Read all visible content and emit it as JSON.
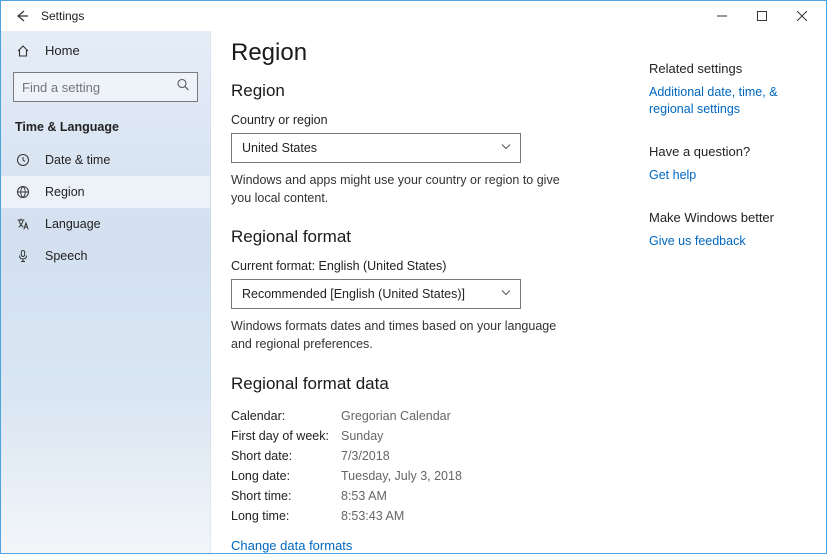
{
  "window": {
    "title": "Settings"
  },
  "sidebar": {
    "home_label": "Home",
    "search_placeholder": "Find a setting",
    "heading": "Time & Language",
    "items": [
      {
        "label": "Date & time"
      },
      {
        "label": "Region"
      },
      {
        "label": "Language"
      },
      {
        "label": "Speech"
      }
    ]
  },
  "page": {
    "title": "Region",
    "region": {
      "heading": "Region",
      "label": "Country or region",
      "value": "United States",
      "helper": "Windows and apps might use your country or region to give you local content."
    },
    "format": {
      "heading": "Regional format",
      "label": "Current format: English (United States)",
      "value": "Recommended [English (United States)]",
      "helper": "Windows formats dates and times based on your language and regional preferences."
    },
    "format_data": {
      "heading": "Regional format data",
      "rows": [
        {
          "k": "Calendar:",
          "v": "Gregorian Calendar"
        },
        {
          "k": "First day of week:",
          "v": "Sunday"
        },
        {
          "k": "Short date:",
          "v": "7/3/2018"
        },
        {
          "k": "Long date:",
          "v": "Tuesday, July 3, 2018"
        },
        {
          "k": "Short time:",
          "v": "8:53 AM"
        },
        {
          "k": "Long time:",
          "v": "8:53:43 AM"
        }
      ],
      "change_link": "Change data formats"
    }
  },
  "aside": {
    "related": {
      "heading": "Related settings",
      "link": "Additional date, time, & regional settings"
    },
    "question": {
      "heading": "Have a question?",
      "link": "Get help"
    },
    "feedback": {
      "heading": "Make Windows better",
      "link": "Give us feedback"
    }
  }
}
